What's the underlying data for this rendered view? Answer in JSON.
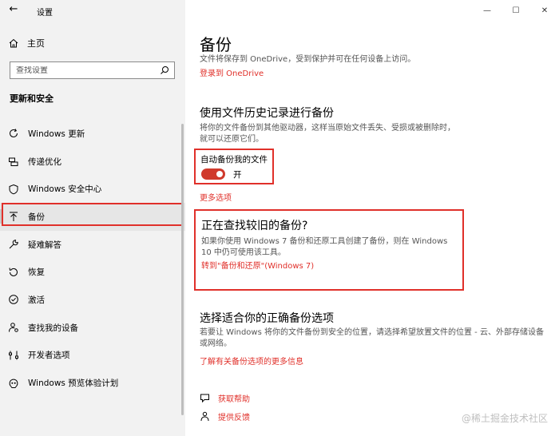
{
  "window": {
    "title": "设置",
    "controls": {
      "minimize": "—",
      "maximize": "☐",
      "close": "✕"
    }
  },
  "sidebar": {
    "back_glyph": "←",
    "home_label": "主页",
    "search_placeholder": "查找设置",
    "section_title": "更新和安全",
    "items": [
      {
        "label": "Windows 更新",
        "icon": "refresh-icon"
      },
      {
        "label": "传递优化",
        "icon": "delivery-icon"
      },
      {
        "label": "Windows 安全中心",
        "icon": "shield-icon"
      },
      {
        "label": "备份",
        "icon": "backup-arrow-icon",
        "active": true
      },
      {
        "label": "疑难解答",
        "icon": "wrench-icon"
      },
      {
        "label": "恢复",
        "icon": "recovery-icon"
      },
      {
        "label": "激活",
        "icon": "check-circle-icon"
      },
      {
        "label": "查找我的设备",
        "icon": "person-location-icon"
      },
      {
        "label": "开发者选项",
        "icon": "developer-icon"
      },
      {
        "label": "Windows 预览体验计划",
        "icon": "insider-icon"
      }
    ]
  },
  "main": {
    "title": "备份",
    "intro": "文件将保存到 OneDrive，受到保护并可在任何设备上访问。",
    "onedrive_link": "登录到 OneDrive",
    "file_history": {
      "heading": "使用文件历史记录进行备份",
      "description": "将你的文件备份到其他驱动器，这样当原始文件丢失、受损或被删除时，就可以还原它们。",
      "auto_backup_label": "自动备份我的文件",
      "toggle_state": "开",
      "more_options_link": "更多选项"
    },
    "older_backup": {
      "heading": "正在查找较旧的备份?",
      "description": "如果你使用 Windows 7 备份和还原工具创建了备份，则在 Windows 10 中仍可使用该工具。",
      "link": "转到\"备份和还原\"(Windows 7)"
    },
    "choose": {
      "heading": "选择适合你的正确备份选项",
      "description": "若要让 Windows 将你的文件备份到安全的位置，请选择希望放置文件的位置 - 云、外部存储设备或网络。",
      "link": "了解有关备份选项的更多信息"
    },
    "help": {
      "get_help": "获取帮助",
      "feedback": "提供反馈"
    }
  },
  "watermark": "@稀土掘金技术社区",
  "colors": {
    "accent": "#e0302a",
    "toggle_on": "#d03a2c",
    "sidebar_bg": "#f2f2f2"
  }
}
